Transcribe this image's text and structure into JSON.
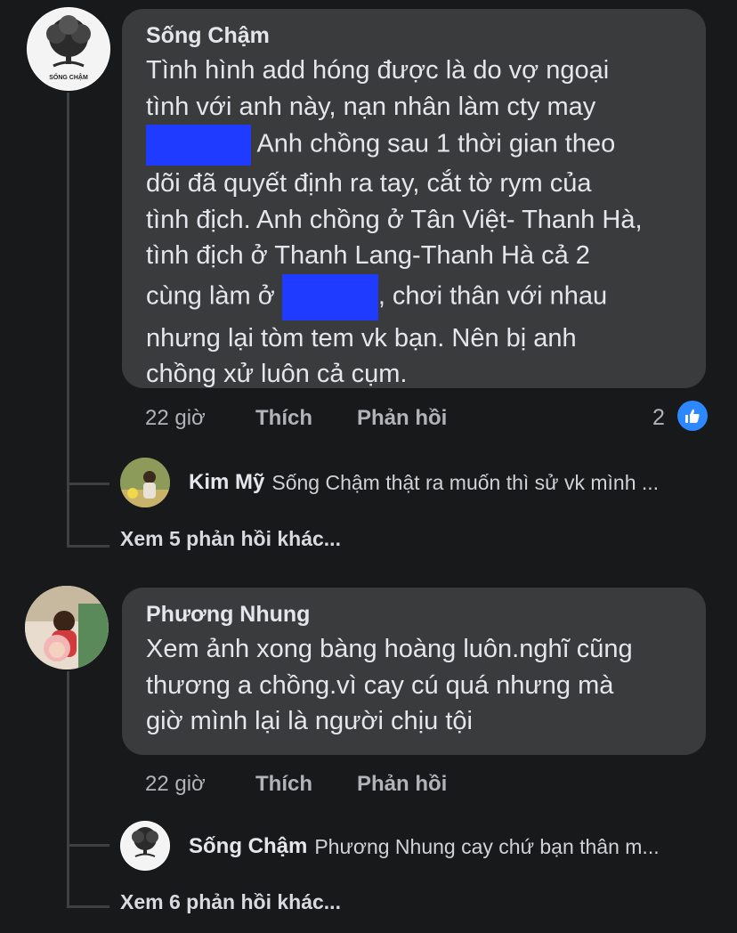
{
  "comments": [
    {
      "author": "Sống Chậm",
      "avatar_caption": "SỐNG CHẬM",
      "lines": [
        "Tình hình add hóng được là do vợ ngoại",
        "tình với anh này, nạn nhân làm cty may",
        [
          "",
          " Anh chồng sau 1 thời gian theo"
        ],
        "dõi đã quyết định ra tay, cắt tờ rym của",
        "tình địch. Anh chồng ở Tân Việt- Thanh Hà,",
        "tình địch ở Thanh Lang-Thanh Hà cả 2",
        [
          "cùng làm ở ",
          ", chơi thân với nhau"
        ],
        "nhưng lại tòm tem vk bạn. Nên bị anh",
        "chồng xử luôn cả cụm."
      ],
      "time": "22 giờ",
      "like_label": "Thích",
      "reply_label": "Phản hồi",
      "reaction_count": "2",
      "reply_preview": {
        "name": "Kim Mỹ",
        "text": "Sống Chậm thật ra muốn thì sử vk mình ..."
      },
      "more_replies": "Xem 5 phản hồi khác..."
    },
    {
      "author": "Phương Nhung",
      "lines": [
        "Xem ảnh xong bàng hoàng luôn.nghĩ cũng",
        "thương a chồng.vì cay cú quá nhưng mà",
        "giờ mình lại là người chịu tội"
      ],
      "time": "22 giờ",
      "like_label": "Thích",
      "reply_label": "Phản hồi",
      "reply_preview": {
        "name": "Sống Chậm",
        "text": "Phương Nhung cay chứ bạn thân m..."
      },
      "more_replies": "Xem 6 phản hồi khác..."
    }
  ],
  "colors": {
    "background": "#18191a",
    "bubble": "#3a3b3c",
    "redaction": "#1f3bff",
    "like_blue": "#2d88ff",
    "secondary_text": "#b0b3b8"
  },
  "icons": [
    "tree-logo-avatar",
    "like-thumb-icon",
    "photo-avatar"
  ]
}
